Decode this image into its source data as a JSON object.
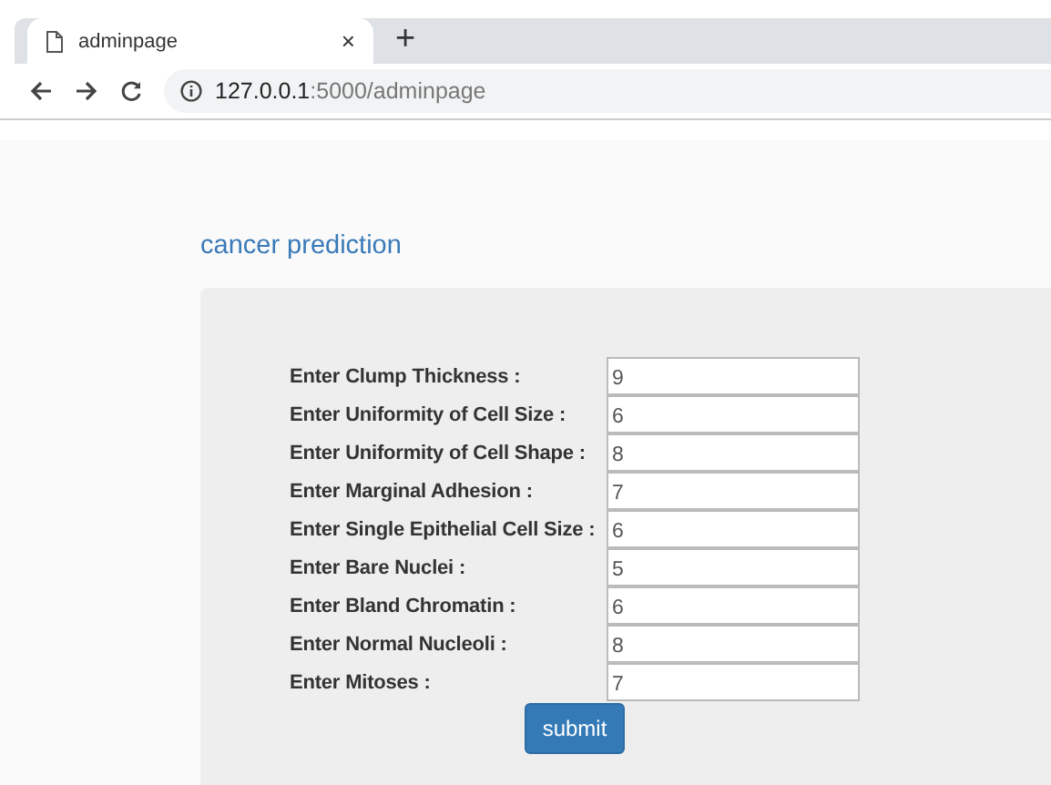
{
  "browser": {
    "tab": {
      "title": "adminpage",
      "close": "×",
      "selected": true
    },
    "new_tab": "+",
    "url_host": "127.0.0.1",
    "url_path": ":5000/adminpage"
  },
  "page": {
    "title": "cancer prediction",
    "fields": [
      {
        "label": "Enter Clump Thickness :",
        "value": "9"
      },
      {
        "label": "Enter Uniformity of Cell Size :",
        "value": "6"
      },
      {
        "label": "Enter Uniformity of Cell Shape :",
        "value": "8"
      },
      {
        "label": "Enter Marginal Adhesion :",
        "value": "7"
      },
      {
        "label": "Enter Single Epithelial Cell Size :",
        "value": "6"
      },
      {
        "label": "Enter Bare Nuclei :",
        "value": "5"
      },
      {
        "label": "Enter Bland Chromatin :",
        "value": "6"
      },
      {
        "label": "Enter Normal Nucleoli :",
        "value": "8"
      },
      {
        "label": "Enter Mitoses :",
        "value": "7"
      }
    ],
    "submit": "submit"
  }
}
